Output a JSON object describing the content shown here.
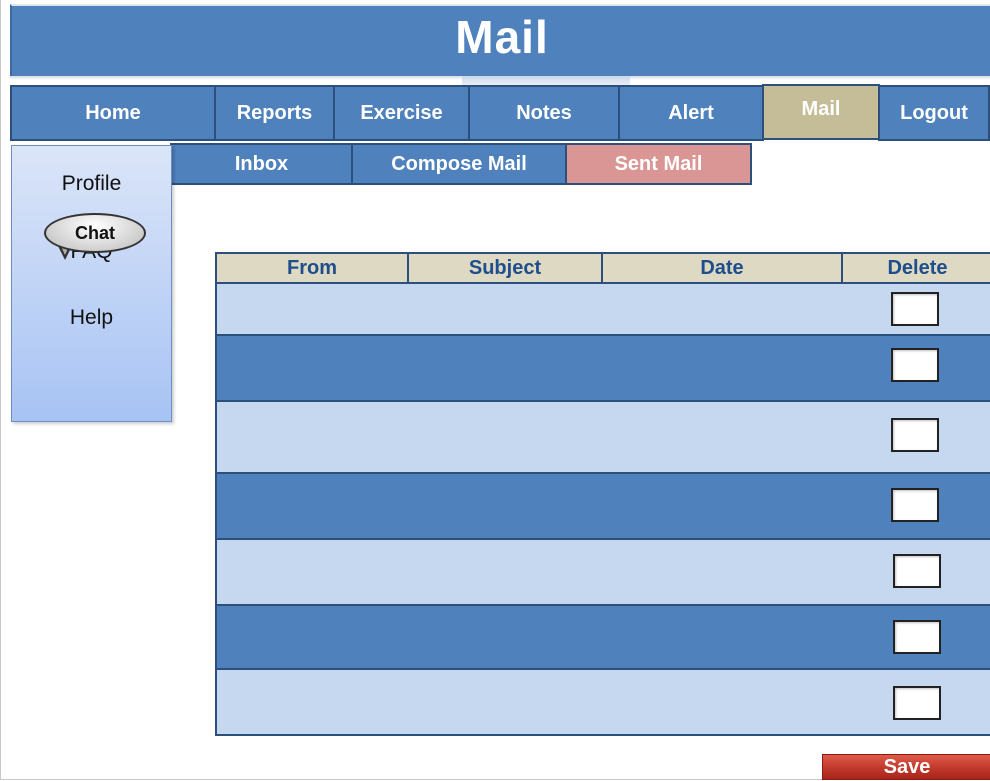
{
  "header": {
    "title": "Mail"
  },
  "nav": {
    "items": [
      {
        "label": "Home",
        "active": false
      },
      {
        "label": "Reports",
        "active": false
      },
      {
        "label": "Exercise",
        "active": false
      },
      {
        "label": "Notes",
        "active": false
      },
      {
        "label": "Alert",
        "active": false
      },
      {
        "label": "Mail",
        "active": true
      },
      {
        "label": "Logout",
        "active": false
      }
    ]
  },
  "subnav": {
    "items": [
      {
        "label": "Inbox",
        "active": false
      },
      {
        "label": "Compose Mail",
        "active": false
      },
      {
        "label": "Sent Mail",
        "active": true
      }
    ]
  },
  "sidebar": {
    "links": [
      "Profile",
      "FAQ",
      "Help"
    ],
    "chat_label": "Chat"
  },
  "table": {
    "columns": [
      "From",
      "Subject",
      "Date",
      "Delete"
    ],
    "rows": [
      {
        "from": "",
        "subject": "",
        "date": "",
        "delete_checked": false
      },
      {
        "from": "",
        "subject": "",
        "date": "",
        "delete_checked": false
      },
      {
        "from": "",
        "subject": "",
        "date": "",
        "delete_checked": false
      },
      {
        "from": "",
        "subject": "",
        "date": "",
        "delete_checked": false
      },
      {
        "from": "",
        "subject": "",
        "date": "",
        "delete_checked": false
      },
      {
        "from": "",
        "subject": "",
        "date": "",
        "delete_checked": false
      },
      {
        "from": "",
        "subject": "",
        "date": "",
        "delete_checked": false
      }
    ]
  },
  "actions": {
    "save_label": "Save"
  },
  "colors": {
    "primary_blue": "#4f81bd",
    "active_tab": "#c4bd97",
    "active_subtab": "#d99694",
    "header_row": "#ddd9c3",
    "light_row": "#c6d8ef",
    "save_red": "#c0392b"
  }
}
